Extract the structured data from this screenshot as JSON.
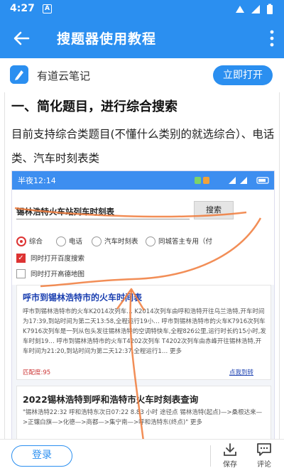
{
  "status": {
    "time": "4:27",
    "notify_glyph": "A"
  },
  "appbar": {
    "title": "搜题器使用教程"
  },
  "youdao": {
    "name": "有道云笔记",
    "open_label": "立即打开"
  },
  "article": {
    "heading": "一、简化题目，进行综合搜索",
    "paragraph": "目前支持综合类题目(不懂什么类别的就选综合）、电话类、汽车时刻表类",
    "screenshot": {
      "status_time": "半夜12:14",
      "query": "锡林浩特火车站列车时刻表",
      "search_label": "搜索",
      "radios": [
        "综合",
        "电话",
        "汽车时刻表",
        "同城答主专用（付"
      ],
      "checks": [
        "同时打开百度搜索",
        "同时打开高德地图"
      ],
      "result1": {
        "title": "呼市到锡林浩特市的火车时间表",
        "body": "呼市到锡林浩特市的火车K2014次列车… K2014次列车由呼和浩特开往乌兰浩特,开车时间为17:39,到站时间为第二天13:58,全程运行19小… 呼市到锡林浩特市的火车K7916次列车 K7916次列车是一列从包头发往锡林浩特的空调特快车,全程826公里,运行时长约15小时,发车时刻19… 呼市到锡林浩特市的火车T4202次列车 T4202次列车由赤峰开往锡林浩特,开车时间为21:20,到站时间为第二天12:37,全程运行1… 更多",
        "score": "匹配度:95",
        "link": "点我到转"
      },
      "result2": {
        "title": "2022锡林浩特到呼和浩特市火车时刻表查询",
        "body": "\"锡林浩特22:32 呼和浩特东次日07:22 8.83 小时 途径点 锡林浩特(起点)—>桑根达来—>正镶白旗—>化德—>商都—>集宁南—>呼和浩特东(终点)\" 更多"
      }
    }
  },
  "bottombar": {
    "login_label": "登录",
    "save_label": "保存",
    "comment_label": "评论"
  },
  "colors": {
    "primary": "#2b8ff0",
    "annotation": "#f07a3a",
    "radio_selected": "#dd3333"
  }
}
